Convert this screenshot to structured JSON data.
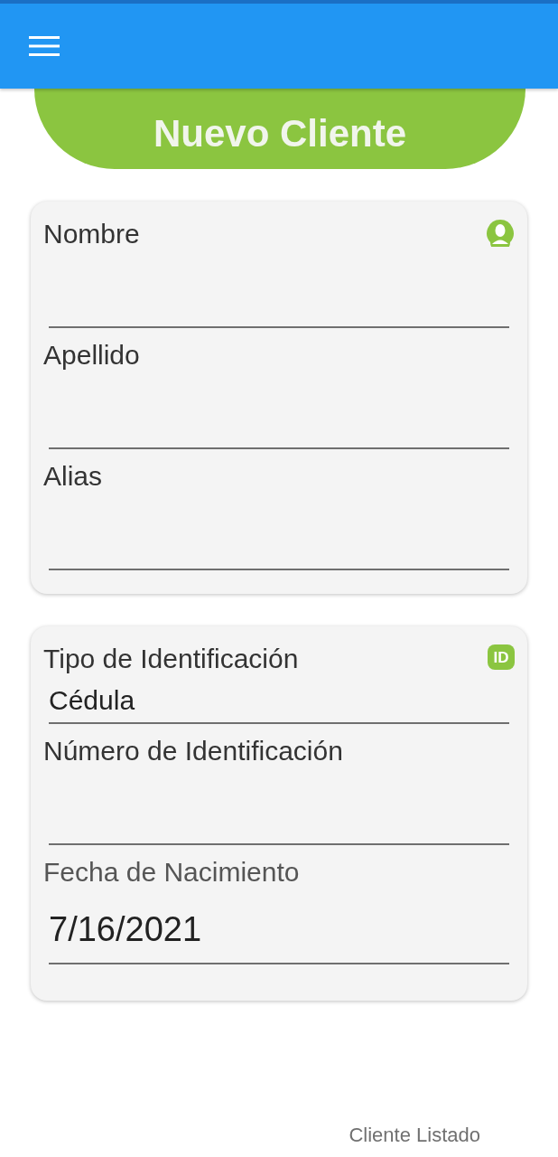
{
  "banner": {
    "title": "Nuevo Cliente"
  },
  "cards": [
    {
      "icon": {
        "kind": "person"
      },
      "fields": [
        {
          "kind": "text",
          "label": "Nombre"
        },
        {
          "kind": "text",
          "label": "Apellido"
        },
        {
          "kind": "text",
          "label": "Alias"
        }
      ]
    },
    {
      "icon": {
        "kind": "id",
        "text": "ID"
      },
      "fields": [
        {
          "kind": "picker",
          "label": "Tipo de Identificación",
          "value": "Cédula"
        },
        {
          "kind": "text",
          "label": "Número de Identificación"
        },
        {
          "kind": "date",
          "label": "Fecha de Nacimiento",
          "value": "7/16/2021"
        }
      ]
    }
  ],
  "footer": {
    "link": "Cliente Listado"
  }
}
